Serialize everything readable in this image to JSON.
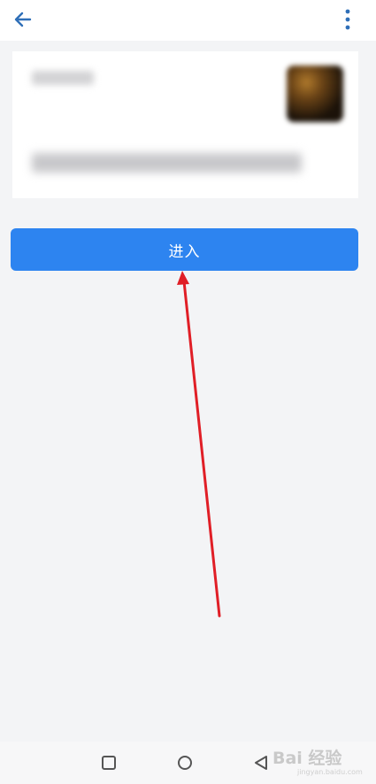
{
  "top_bar": {
    "back_icon": "arrow-left-icon",
    "more_icon": "more-vert-icon",
    "icon_color": "#2f6fb8"
  },
  "card": {
    "title_text": "",
    "description_text": "",
    "thumbnail": "blurred-image"
  },
  "enter_button": {
    "label": "进入",
    "color": "#2d84f0"
  },
  "annotation": {
    "arrow_color": "#e01e26",
    "points_to": "enter-button"
  },
  "bottom_nav": {
    "recents_icon": "square-icon",
    "home_icon": "circle-icon",
    "back_icon": "triangle-back-icon"
  },
  "watermark": {
    "brand": "Bai 经验",
    "url": "jingyan.baidu.com"
  }
}
